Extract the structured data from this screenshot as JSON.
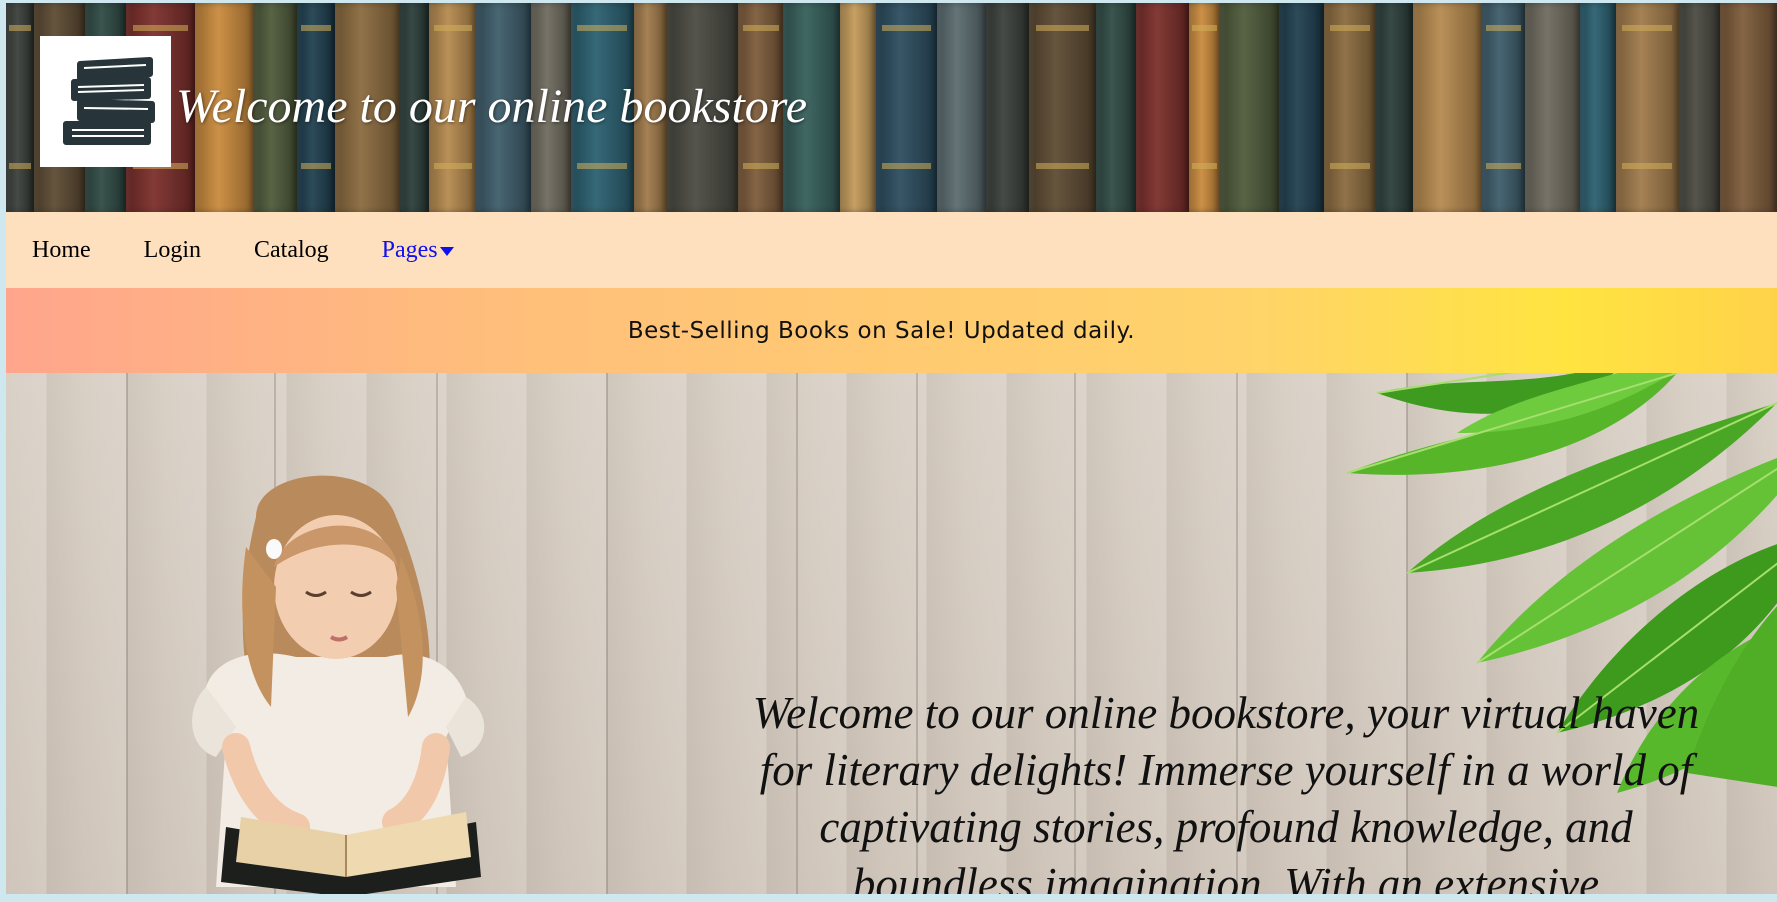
{
  "header": {
    "title": "Welcome to our online bookstore",
    "logo_icon": "book-stack-icon"
  },
  "nav": {
    "items": [
      {
        "label": "Home"
      },
      {
        "label": "Login"
      },
      {
        "label": "Catalog"
      },
      {
        "label": "Pages"
      }
    ],
    "dropdown_icon": "caret-down-icon",
    "active_link_color": "#1010ee",
    "background": "#ffe0be"
  },
  "sale_banner": {
    "text": "Best-Selling Books on Sale! Updated daily."
  },
  "hero": {
    "text": "Welcome to our online bookstore, your virtual haven for literary delights! Immerse yourself in a world of captivating stories, profound knowledge, and boundless imagination. With an extensive"
  },
  "colors": {
    "nav_bg": "#ffe0be",
    "banner_start": "#ffa58c",
    "banner_end": "#ffe440",
    "logo_ink": "#27353b"
  }
}
